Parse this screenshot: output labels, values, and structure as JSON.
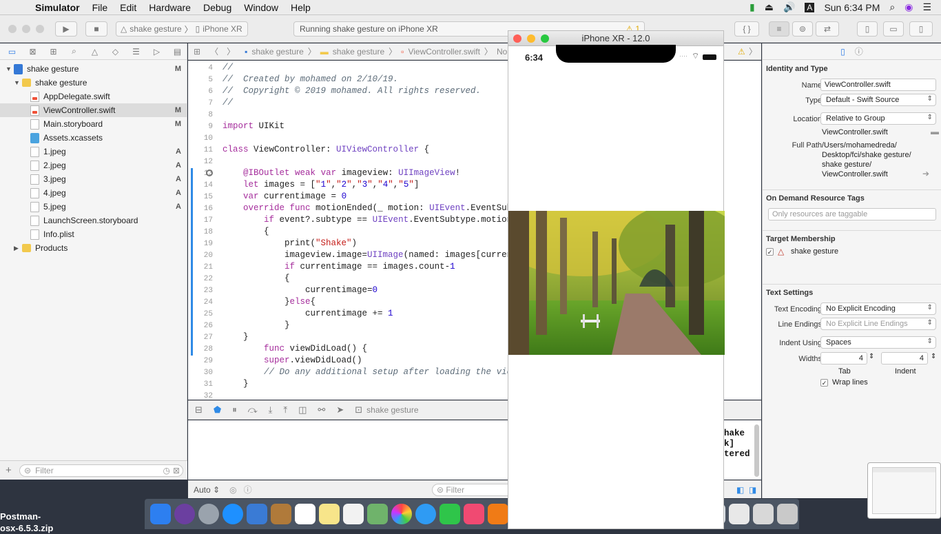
{
  "menubar": {
    "apple": "",
    "app_name": "Simulator",
    "menus": [
      "File",
      "Edit",
      "Hardware",
      "Debug",
      "Window",
      "Help"
    ],
    "time": "Sun 6:34 PM"
  },
  "toolbar": {
    "scheme": "shake gesture",
    "device": "iPhone XR",
    "activity": "Running shake gesture on iPhone XR",
    "warning_count": "1"
  },
  "navigator": {
    "items": [
      {
        "label": "shake gesture",
        "badge": "M",
        "indent": 0,
        "icon": "project-icon"
      },
      {
        "label": "shake gesture",
        "badge": "",
        "indent": 1,
        "icon": "folder-icon"
      },
      {
        "label": "AppDelegate.swift",
        "badge": "",
        "indent": 2,
        "icon": "swift-file-icon"
      },
      {
        "label": "ViewController.swift",
        "badge": "M",
        "indent": 2,
        "icon": "swift-file-icon"
      },
      {
        "label": "Main.storyboard",
        "badge": "M",
        "indent": 2,
        "icon": "storyboard-icon"
      },
      {
        "label": "Assets.xcassets",
        "badge": "",
        "indent": 2,
        "icon": "assets-icon"
      },
      {
        "label": "1.jpeg",
        "badge": "A",
        "indent": 2,
        "icon": "image-file-icon"
      },
      {
        "label": "2.jpeg",
        "badge": "A",
        "indent": 2,
        "icon": "image-file-icon"
      },
      {
        "label": "3.jpeg",
        "badge": "A",
        "indent": 2,
        "icon": "image-file-icon"
      },
      {
        "label": "4.jpeg",
        "badge": "A",
        "indent": 2,
        "icon": "image-file-icon"
      },
      {
        "label": "5.jpeg",
        "badge": "A",
        "indent": 2,
        "icon": "image-file-icon"
      },
      {
        "label": "LaunchScreen.storyboard",
        "badge": "",
        "indent": 2,
        "icon": "storyboard-icon"
      },
      {
        "label": "Info.plist",
        "badge": "",
        "indent": 2,
        "icon": "plist-icon"
      },
      {
        "label": "Products",
        "badge": "",
        "indent": 1,
        "icon": "folder-icon"
      }
    ],
    "filter_placeholder": "Filter"
  },
  "jumpbar": {
    "crumbs": [
      "shake gesture",
      "shake gesture",
      "ViewController.swift",
      "No Sele"
    ]
  },
  "editor": {
    "lines": [
      {
        "n": "4",
        "t": "//"
      },
      {
        "n": "5",
        "t": "//  Created by mohamed on 2/10/19."
      },
      {
        "n": "6",
        "t": "//  Copyright © 2019 mohamed. All rights reserved."
      },
      {
        "n": "7",
        "t": "//"
      },
      {
        "n": "8",
        "t": ""
      },
      {
        "n": "9",
        "t": "import UIKit"
      },
      {
        "n": "10",
        "t": ""
      },
      {
        "n": "11",
        "t": "class ViewController: UIViewController {"
      },
      {
        "n": "12",
        "t": ""
      },
      {
        "n": "13",
        "t": "    @IBOutlet weak var imageview: UIImageView!"
      },
      {
        "n": "14",
        "t": "    let images = [\"1\",\"2\",\"3\",\"4\",\"5\"]"
      },
      {
        "n": "15",
        "t": "    var currentimage = 0"
      },
      {
        "n": "16",
        "t": "    override func motionEnded(_ motion: UIEvent.EventSub"
      },
      {
        "n": "17",
        "t": "        if event?.subtype == UIEvent.EventSubtype.motion"
      },
      {
        "n": "18",
        "t": "        {"
      },
      {
        "n": "19",
        "t": "            print(\"Shake\")"
      },
      {
        "n": "20",
        "t": "            imageview.image=UIImage(named: images[curren"
      },
      {
        "n": "21",
        "t": "            if currentimage == images.count-1"
      },
      {
        "n": "22",
        "t": "            {"
      },
      {
        "n": "23",
        "t": "                currentimage=0"
      },
      {
        "n": "24",
        "t": "            }else{"
      },
      {
        "n": "25",
        "t": "                currentimage += 1"
      },
      {
        "n": "26",
        "t": "            }"
      },
      {
        "n": "27",
        "t": "    }"
      },
      {
        "n": "28",
        "t": "        func viewDidLoad() {"
      },
      {
        "n": "29",
        "t": "        super.viewDidLoad()"
      },
      {
        "n": "30",
        "t": "        // Do any additional setup after loading the vie"
      },
      {
        "n": "31",
        "t": "    }"
      },
      {
        "n": "32",
        "t": ""
      }
    ]
  },
  "debugbar": {
    "target": "shake gesture"
  },
  "console": {
    "text": "hake\nk]\ntered",
    "mode": "Auto",
    "filter_placeholder": "Filter"
  },
  "simulator": {
    "title": "iPhone XR - 12.0",
    "time": "6:34"
  },
  "inspector": {
    "identity_header": "Identity and Type",
    "name_label": "Name",
    "name_value": "ViewController.swift",
    "type_label": "Type",
    "type_value": "Default - Swift Source",
    "location_label": "Location",
    "location_value": "Relative to Group",
    "location_file": "ViewController.swift",
    "fullpath_label": "Full Path",
    "fullpath_lines": [
      "/Users/mohamedreda/",
      "Desktop/fci/shake gesture/",
      "shake gesture/",
      "ViewController.swift"
    ],
    "ondemand_header": "On Demand Resource Tags",
    "ondemand_placeholder": "Only resources are taggable",
    "target_header": "Target Membership",
    "target_item": "shake gesture",
    "text_header": "Text Settings",
    "encoding_label": "Text Encoding",
    "encoding_value": "No Explicit Encoding",
    "endings_label": "Line Endings",
    "endings_value": "No Explicit Line Endings",
    "indent_label": "Indent Using",
    "indent_value": "Spaces",
    "widths_label": "Widths",
    "tab_value": "4",
    "indent_width_value": "4",
    "tab_caption": "Tab",
    "indent_caption": "Indent",
    "wrap_label": "Wrap lines"
  },
  "desktop": {
    "file_label": "Postman-\nosx-6.5.3.zip"
  },
  "colors": {
    "accent": "#2f7ce6",
    "keyword": "#a52d9c",
    "string": "#c41a16",
    "comment": "#5d6c79"
  }
}
